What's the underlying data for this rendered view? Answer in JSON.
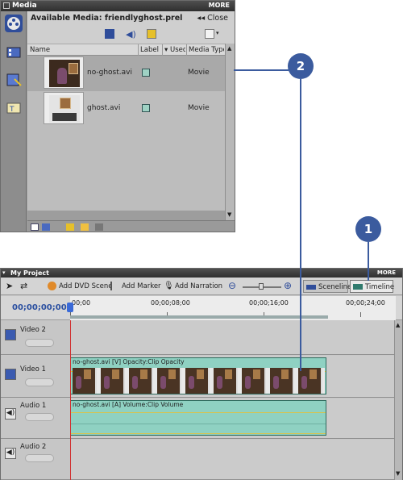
{
  "media_panel": {
    "title": "Media",
    "more": "MORE",
    "available_label": "Available Media: friendlyghost.prel",
    "close_label": "Close",
    "columns": [
      "Name",
      "Label",
      "Used",
      "Media Type"
    ],
    "clips": [
      {
        "name": "no-ghost.avi",
        "label_color": "#9fd2c4",
        "media_type": "Movie"
      },
      {
        "name": "ghost.avi",
        "label_color": "#9fd2c4",
        "media_type": "Movie"
      }
    ],
    "rail_icons": [
      "film-reel-icon",
      "film-icon",
      "effects-icon",
      "titles-icon"
    ]
  },
  "project_panel": {
    "title": "My Project",
    "more": "MORE",
    "toolbar": {
      "add_dvd_scene": "Add DVD Scene",
      "add_marker": "Add Marker",
      "add_narration": "Add Narration",
      "sceneline": "Sceneline",
      "timeline": "Timeline"
    },
    "timecode": "00;00;00;00",
    "ruler_ticks": [
      "00;00",
      "00;00;08;00",
      "00;00;16;00",
      "00;00;24;00"
    ],
    "tracks": [
      {
        "name": "Video 2"
      },
      {
        "name": "Video 1",
        "clip_title": "no-ghost.avi [V] Opacity:Clip Opacity"
      },
      {
        "name": "Audio 1",
        "clip_title": "no-ghost.avi [A] Volume:Clip Volume"
      },
      {
        "name": "Audio 2"
      }
    ]
  },
  "callouts": [
    "1",
    "2"
  ],
  "colors": {
    "accent": "#3b5b9e",
    "clip": "#8fd1c2",
    "timecode": "#2a4fa0",
    "playhead": "#d03030"
  }
}
